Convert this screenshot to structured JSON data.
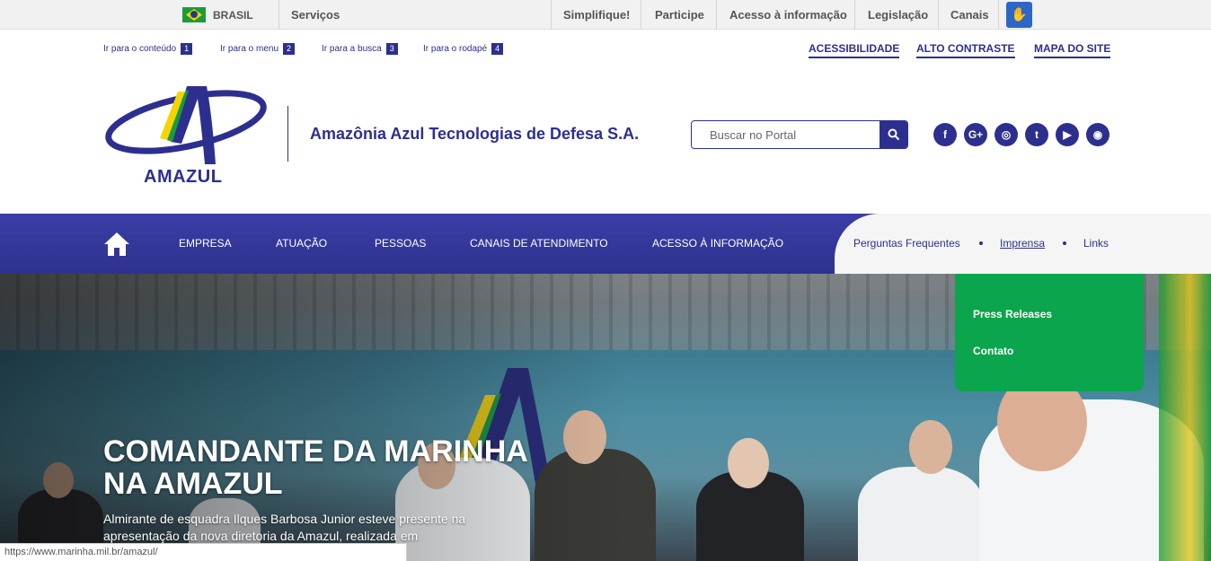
{
  "govbar": {
    "country": "BRASIL",
    "services": "Serviços",
    "links": [
      "Simplifique!",
      "Participe",
      "Acesso à informação",
      "Legislação",
      "Canais"
    ]
  },
  "skiplinks": [
    {
      "label": "Ir para o conteúdo",
      "num": "1"
    },
    {
      "label": "Ir para o menu",
      "num": "2"
    },
    {
      "label": "Ir para a busca",
      "num": "3"
    },
    {
      "label": "Ir para o rodapé",
      "num": "4"
    }
  ],
  "accessibility": [
    "ACESSIBILIDADE",
    "ALTO CONTRASTE",
    "MAPA DO SITE"
  ],
  "header": {
    "logo_text": "AMAZUL",
    "site_name": "Amazônia Azul Tecnologias de Defesa S.A.",
    "search_placeholder": "Buscar no Portal"
  },
  "social": [
    {
      "icon": "facebook-icon",
      "glyph": "f"
    },
    {
      "icon": "google-plus-icon",
      "glyph": "G+"
    },
    {
      "icon": "instagram-icon",
      "glyph": "◎"
    },
    {
      "icon": "twitter-icon",
      "glyph": "t"
    },
    {
      "icon": "youtube-icon",
      "glyph": "▶"
    },
    {
      "icon": "rss-icon",
      "glyph": "◉"
    }
  ],
  "nav": {
    "items": [
      "EMPRESA",
      "ATUAÇÃO",
      "PESSOAS",
      "CANAIS DE ATENDIMENTO",
      "ACESSO À INFORMAÇÃO"
    ],
    "right": [
      "Perguntas Frequentes",
      "Imprensa",
      "Links"
    ]
  },
  "dropdown": [
    "Press Releases",
    "Contato"
  ],
  "hero": {
    "title": "COMANDANTE DA MARINHA NA AMAZUL",
    "description": "Almirante de esquadra Ilques Barbosa Junior esteve presente na apresentação da nova diretoria da Amazul, realizada em"
  },
  "status_url": "https://www.marinha.mil.br/amazul/",
  "colors": {
    "brand": "#2d2f8f",
    "dropdown": "#0aa54c"
  }
}
